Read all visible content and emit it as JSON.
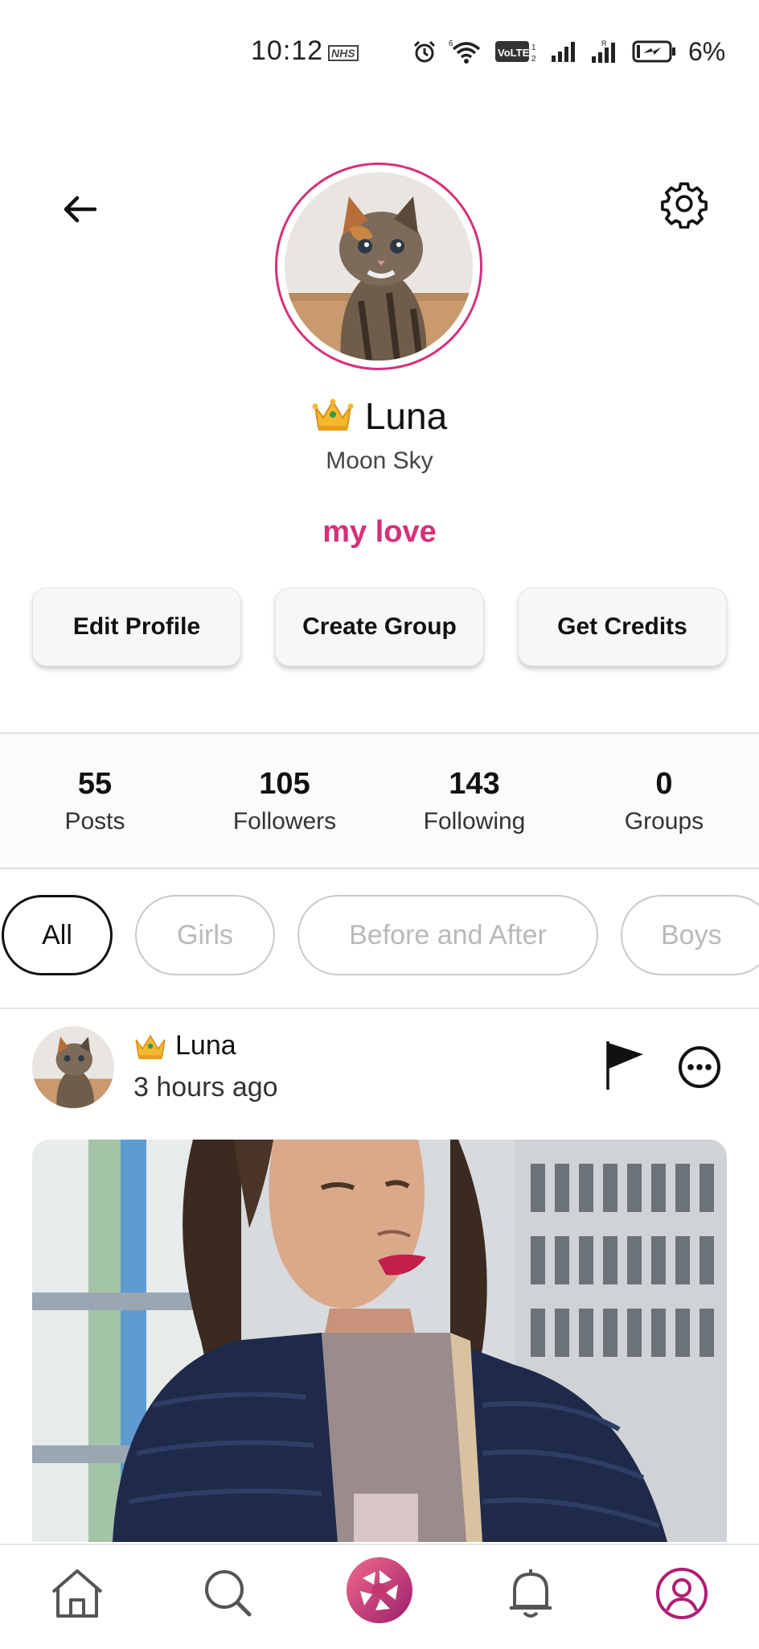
{
  "status_bar": {
    "time": "10:12",
    "nhs_label": "NHS",
    "battery_percent": "6%",
    "icons": [
      "alarm-icon",
      "wifi-icon",
      "volte-icon",
      "signal-icon",
      "signal-roaming-icon",
      "battery-charging-icon"
    ]
  },
  "header": {
    "back_icon": "arrow-left-icon",
    "settings_icon": "gear-icon"
  },
  "profile": {
    "name": "Luna",
    "badge_icon": "crown-icon",
    "handle": "Moon Sky",
    "bio": "my love",
    "accent_color": "#d6307a"
  },
  "actions": {
    "edit_profile": "Edit Profile",
    "create_group": "Create Group",
    "get_credits": "Get Credits"
  },
  "stats": [
    {
      "value": "55",
      "label": "Posts"
    },
    {
      "value": "105",
      "label": "Followers"
    },
    {
      "value": "143",
      "label": "Following"
    },
    {
      "value": "0",
      "label": "Groups"
    }
  ],
  "filters": [
    {
      "label": "All",
      "active": true
    },
    {
      "label": "Girls",
      "active": false
    },
    {
      "label": "Before and After",
      "active": false
    },
    {
      "label": "Boys",
      "active": false
    }
  ],
  "post": {
    "author": "Luna",
    "time": "3 hours ago",
    "flag_icon": "flag-icon",
    "more_icon": "more-options-icon"
  },
  "bottom_nav": [
    {
      "name": "home-icon"
    },
    {
      "name": "search-icon"
    },
    {
      "name": "camera-aperture-icon"
    },
    {
      "name": "bell-icon"
    },
    {
      "name": "profile-icon",
      "active": true
    }
  ]
}
